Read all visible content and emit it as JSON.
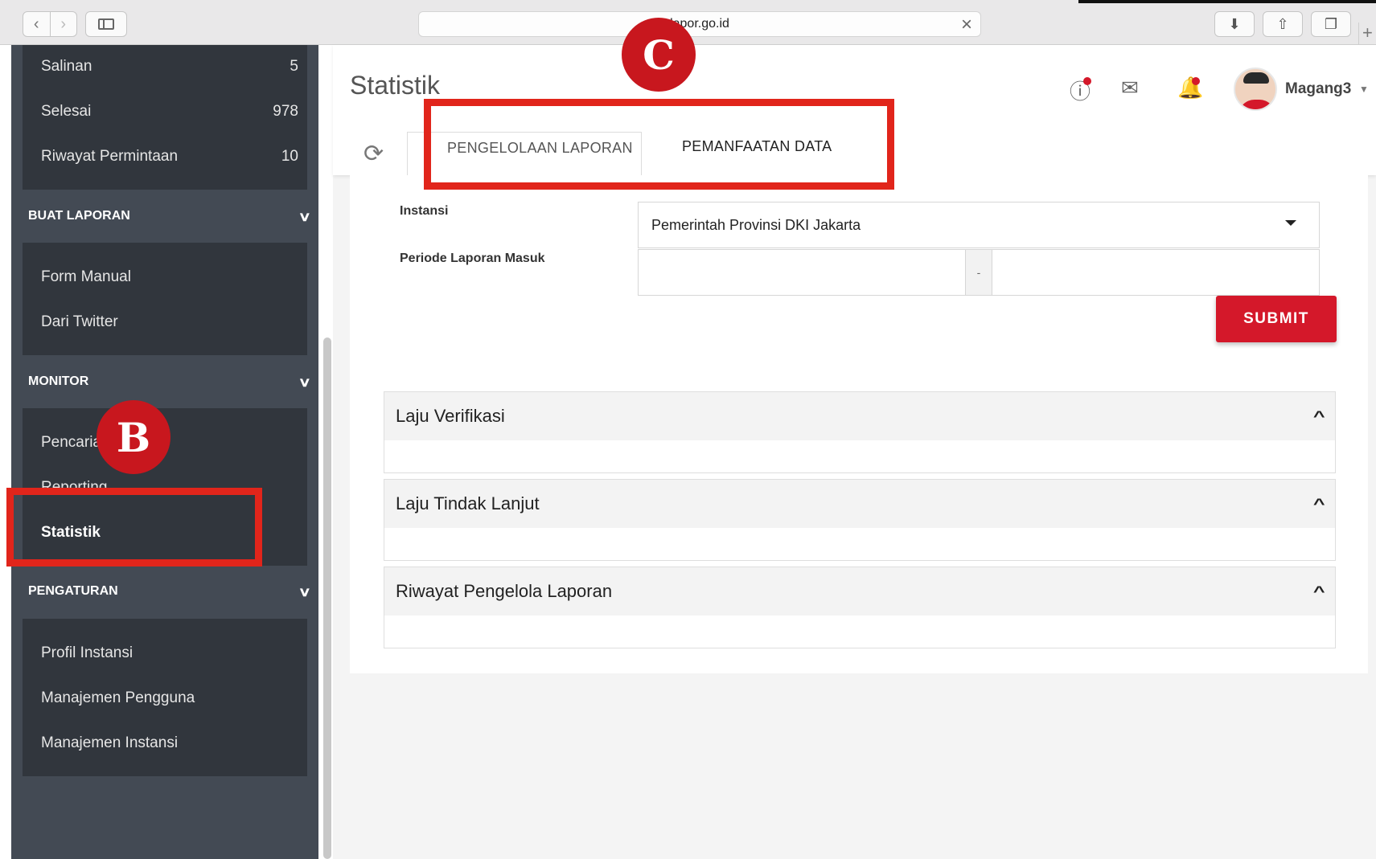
{
  "browser": {
    "url": "lapor.go.id",
    "back_icon": "chevron-left-icon",
    "forward_icon": "chevron-right-icon"
  },
  "sidebar": {
    "items_top": [
      {
        "label": "Salinan",
        "count": "5"
      },
      {
        "label": "Selesai",
        "count": "978"
      },
      {
        "label": "Riwayat Permintaan",
        "count": "10"
      }
    ],
    "sections": [
      {
        "title": "BUAT LAPORAN",
        "items": [
          "Form Manual",
          "Dari Twitter"
        ]
      },
      {
        "title": "MONITOR",
        "items": [
          "Pencarian",
          "Reporting",
          "Statistik"
        ]
      },
      {
        "title": "PENGATURAN",
        "items": [
          "Profil Instansi",
          "Manajemen Pengguna",
          "Manajemen Instansi"
        ]
      }
    ]
  },
  "header": {
    "title": "Statistik",
    "username": "Magang3"
  },
  "tabs": [
    {
      "label": "PENGELOLAAN LAPORAN",
      "active": true
    },
    {
      "label": "PEMANFAATAN DATA",
      "active": false
    }
  ],
  "form": {
    "instansi_label": "Instansi",
    "instansi_value": "Pemerintah Provinsi DKI Jakarta",
    "periode_label": "Periode Laporan Masuk",
    "periode_separator": "-",
    "submit_label": "SUBMIT"
  },
  "panels": [
    {
      "title": "Laju Verifikasi"
    },
    {
      "title": "Laju Tindak Lanjut"
    },
    {
      "title": "Riwayat Pengelola Laporan"
    }
  ],
  "annotations": {
    "b_label": "B",
    "c_label": "C"
  },
  "colors": {
    "accent_red": "#d4182a",
    "sidebar_bg": "#434a54",
    "sidebar_panel": "#31363d"
  }
}
